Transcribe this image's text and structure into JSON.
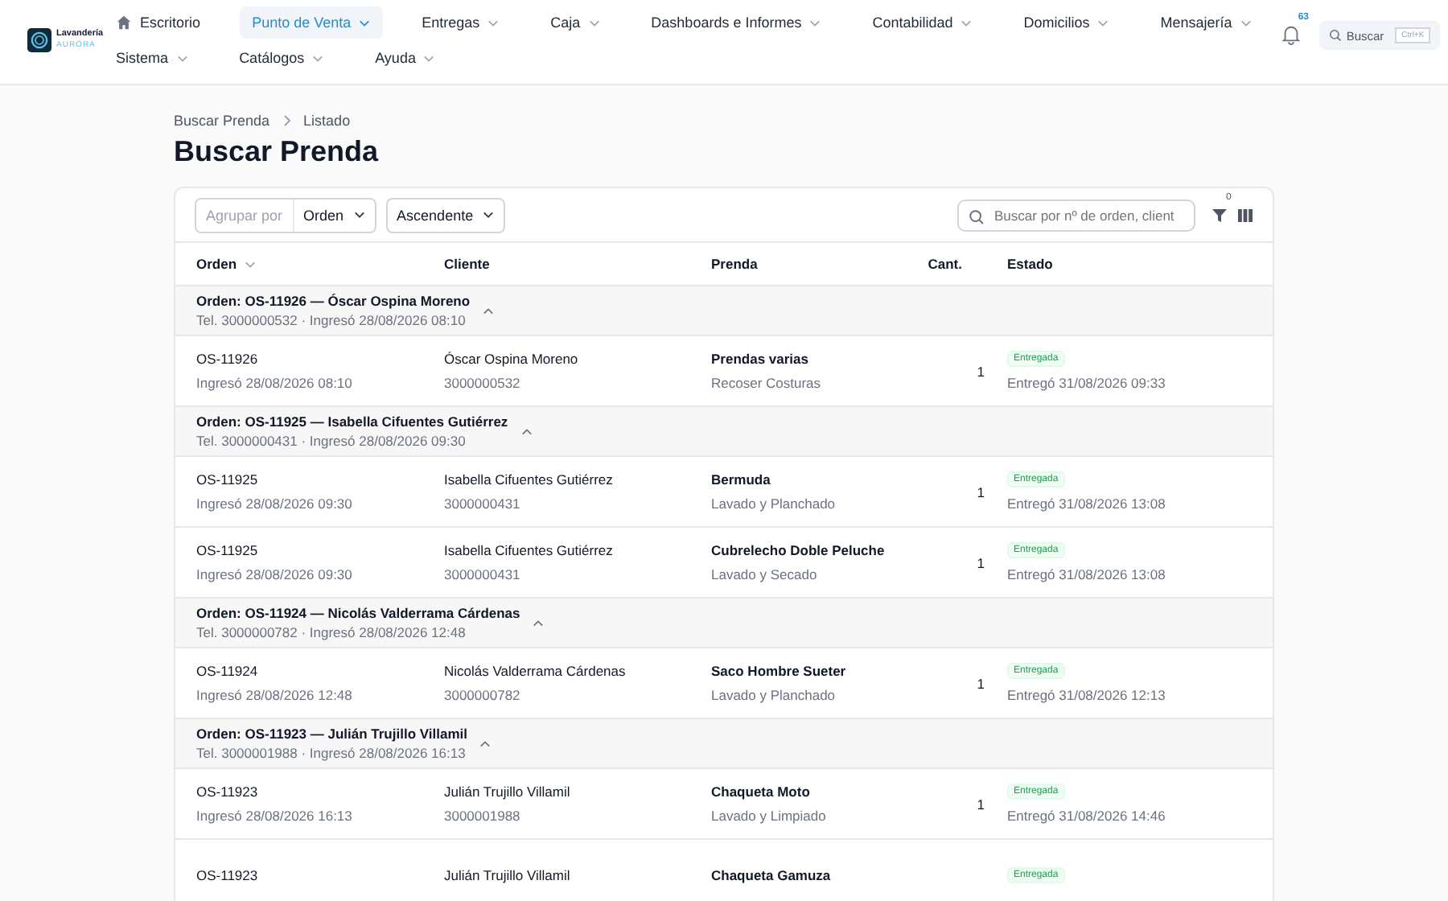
{
  "brand": {
    "name": "Lavandería",
    "subtitle": "AURORA"
  },
  "nav": [
    {
      "label": "Escritorio",
      "kind": "home",
      "selected": false,
      "dropdown": false
    },
    {
      "label": "Punto de Venta",
      "kind": "menu",
      "selected": true,
      "dropdown": true
    },
    {
      "label": "Entregas",
      "kind": "menu",
      "selected": false,
      "dropdown": true
    },
    {
      "label": "Caja",
      "kind": "menu",
      "selected": false,
      "dropdown": true
    },
    {
      "label": "Dashboards e Informes",
      "kind": "menu",
      "selected": false,
      "dropdown": true
    },
    {
      "label": "Contabilidad",
      "kind": "menu",
      "selected": false,
      "dropdown": true
    },
    {
      "label": "Domicilios",
      "kind": "menu",
      "selected": false,
      "dropdown": true
    },
    {
      "label": "Mensajería",
      "kind": "menu",
      "selected": false,
      "dropdown": true
    },
    {
      "label": "Sistema",
      "kind": "menu",
      "selected": false,
      "dropdown": true
    },
    {
      "label": "Catálogos",
      "kind": "menu",
      "selected": false,
      "dropdown": true
    },
    {
      "label": "Ayuda",
      "kind": "menu",
      "selected": false,
      "dropdown": true
    }
  ],
  "notifications": {
    "count": "63"
  },
  "search": {
    "placeholder": "Buscar",
    "shortcut": "Ctrl+K"
  },
  "breadcrumb": [
    "Buscar Prenda",
    "Listado"
  ],
  "title": "Buscar Prenda",
  "toolbar": {
    "group_label": "Agrupar por",
    "group_value": "Orden",
    "sort": "Ascendente",
    "search_placeholder": "Buscar por nº de orden, client",
    "filter_count": "0"
  },
  "columns": [
    {
      "label": "Orden",
      "sortable": true
    },
    {
      "label": "Cliente",
      "sortable": false
    },
    {
      "label": "Prenda",
      "sortable": false
    },
    {
      "label": "Cant.",
      "sortable": false
    },
    {
      "label": "Estado",
      "sortable": false
    }
  ],
  "groups": [
    {
      "title": "Orden: OS-11926 — Óscar Ospina Moreno",
      "subtitle": "Tel. 3000000532 · Ingresó 28/08/2026 08:10",
      "expanded": true,
      "rows": [
        {
          "order": "OS-11926",
          "received": "Ingresó 28/08/2026 08:10",
          "client": "Óscar Ospina Moreno",
          "phone": "3000000532",
          "garment": "Prendas varias",
          "service": "Recoser Costuras",
          "qty": "1",
          "status": "Entregada",
          "delivered": "Entregó 31/08/2026 09:33"
        }
      ]
    },
    {
      "title": "Orden: OS-11925 — Isabella Cifuentes Gutiérrez",
      "subtitle": "Tel. 3000000431 · Ingresó 28/08/2026 09:30",
      "expanded": true,
      "rows": [
        {
          "order": "OS-11925",
          "received": "Ingresó 28/08/2026 09:30",
          "client": "Isabella Cifuentes Gutiérrez",
          "phone": "3000000431",
          "garment": "Bermuda",
          "service": "Lavado y Planchado",
          "qty": "1",
          "status": "Entregada",
          "delivered": "Entregó 31/08/2026 13:08"
        },
        {
          "order": "OS-11925",
          "received": "Ingresó 28/08/2026 09:30",
          "client": "Isabella Cifuentes Gutiérrez",
          "phone": "3000000431",
          "garment": "Cubrelecho Doble Peluche",
          "service": "Lavado y Secado",
          "qty": "1",
          "status": "Entregada",
          "delivered": "Entregó 31/08/2026 13:08"
        }
      ]
    },
    {
      "title": "Orden: OS-11924 — Nicolás Valderrama Cárdenas",
      "subtitle": "Tel. 3000000782 · Ingresó 28/08/2026 12:48",
      "expanded": true,
      "rows": [
        {
          "order": "OS-11924",
          "received": "Ingresó 28/08/2026 12:48",
          "client": "Nicolás Valderrama Cárdenas",
          "phone": "3000000782",
          "garment": "Saco Hombre Sueter",
          "service": "Lavado y Planchado",
          "qty": "1",
          "status": "Entregada",
          "delivered": "Entregó 31/08/2026 12:13"
        }
      ]
    },
    {
      "title": "Orden: OS-11923 — Julián Trujillo Villamil",
      "subtitle": "Tel. 3000001988 · Ingresó 28/08/2026 16:13",
      "expanded": true,
      "rows": [
        {
          "order": "OS-11923",
          "received": "Ingresó 28/08/2026 16:13",
          "client": "Julián Trujillo Villamil",
          "phone": "3000001988",
          "garment": "Chaqueta Moto",
          "service": "Lavado y Limpiado",
          "qty": "1",
          "status": "Entregada",
          "delivered": "Entregó 31/08/2026 14:46"
        },
        {
          "order": "OS-11923",
          "client": "Julián Trujillo Villamil",
          "garment": "Chaqueta Gamuza",
          "status": "Entregada"
        }
      ]
    }
  ]
}
